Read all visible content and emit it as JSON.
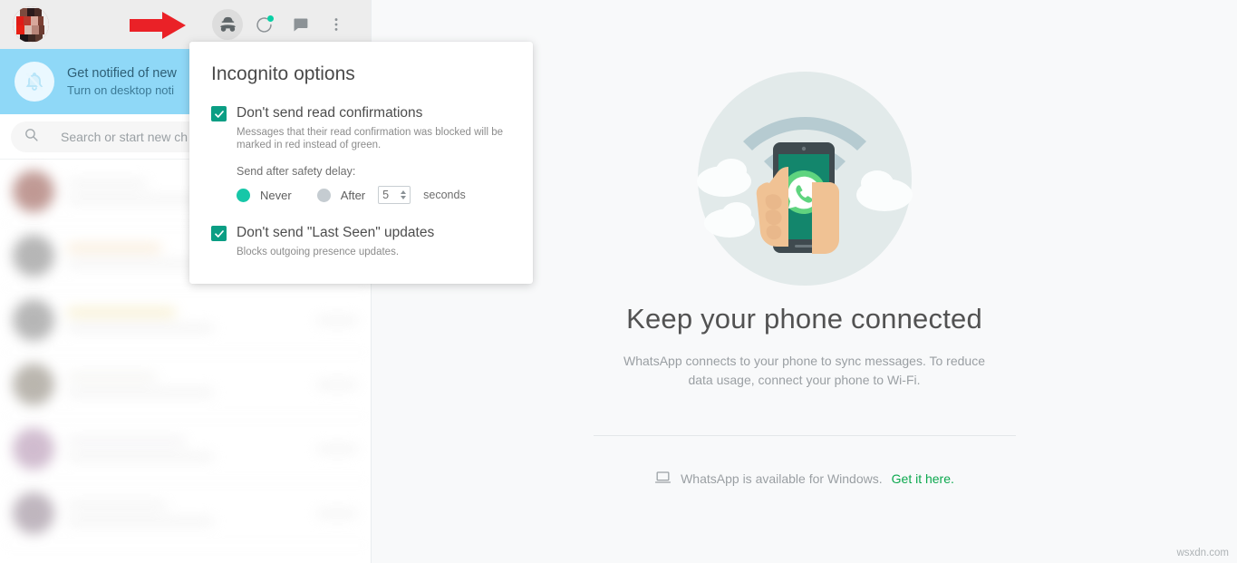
{
  "app": {
    "name": "WhatsApp Web",
    "watermark": "wsxdn.com"
  },
  "colors": {
    "brand_green": "#0ca84e",
    "checkbox_teal": "#0b9e84",
    "radio_on_teal": "#17c7a8",
    "radio_off_gray": "#c5ccd1",
    "notif_banner_blue": "#8fd8f7",
    "status_dot": "#09cfa5",
    "annotation_red": "#ea2127",
    "header_gray": "#ededed"
  },
  "sidebar": {
    "header": {
      "avatar_label": "profile-avatar",
      "icons": [
        {
          "name": "incognito-icon",
          "label": "Incognito options",
          "active": true
        },
        {
          "name": "status-ring-icon",
          "label": "Status",
          "active": false
        },
        {
          "name": "new-chat-icon",
          "label": "New chat",
          "active": false
        },
        {
          "name": "menu-dots-icon",
          "label": "Menu",
          "active": false
        }
      ]
    },
    "notification": {
      "title": "Get notified of new",
      "subtitle": "Turn on desktop noti",
      "icon": "bell-muted-icon"
    },
    "search": {
      "placeholder": "Search or start new ch",
      "icon": "search-icon"
    },
    "chats": [
      {
        "avatar_color": "#a8736c",
        "title_color": "#efefef"
      },
      {
        "avatar_color": "#9a9a9a",
        "title_color": "#f6e3c8"
      },
      {
        "avatar_color": "#9b9b9b",
        "title_color": "#f3e7b8"
      },
      {
        "avatar_color": "#a09a90",
        "title_color": "#eeeeee"
      },
      {
        "avatar_color": "#bfa3bd",
        "title_color": "#efefef"
      },
      {
        "avatar_color": "#a79aa6",
        "title_color": "#efefef"
      }
    ]
  },
  "popup": {
    "title": "Incognito options",
    "option1": {
      "label": "Don't send read confirmations",
      "description": "Messages that their read confirmation was blocked will be marked in red instead of green.",
      "checked": true
    },
    "delay": {
      "label": "Send after safety delay:",
      "never_label": "Never",
      "after_label": "After",
      "seconds_value": "5",
      "seconds_label": "seconds",
      "selected": "Never"
    },
    "option2": {
      "label": "Don't send \"Last Seen\" updates",
      "description": "Blocks outgoing presence updates.",
      "checked": true
    }
  },
  "intro": {
    "title": "Keep your phone connected",
    "subtitle": "WhatsApp connects to your phone to sync messages. To reduce data usage, connect your phone to Wi-Fi.",
    "footer_text": "WhatsApp is available for Windows.",
    "footer_link": "Get it here.",
    "footer_icon": "laptop-icon",
    "illustration": "phone-in-hand-wifi-illustration"
  },
  "annotation": {
    "arrow": "red-arrow-pointing-right"
  }
}
